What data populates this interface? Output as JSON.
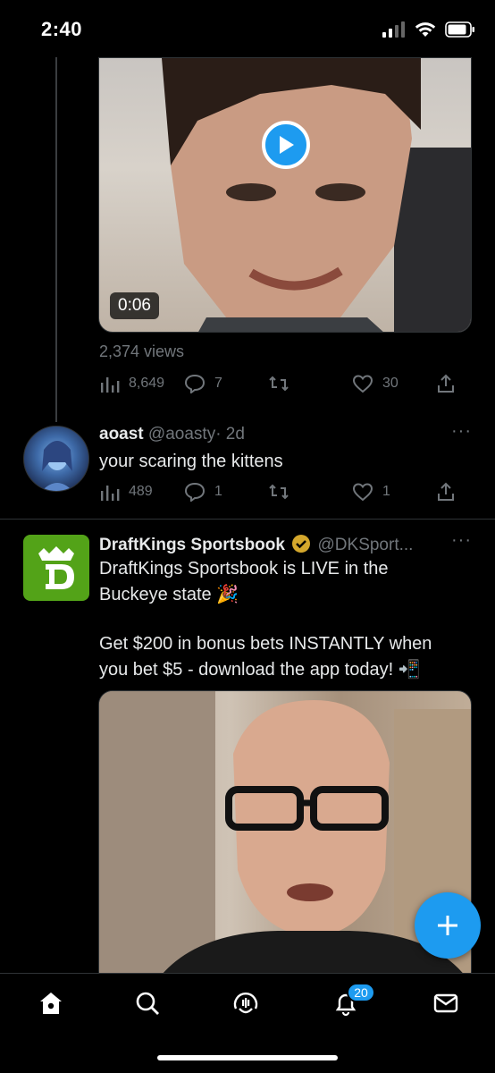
{
  "status_bar": {
    "time": "2:40"
  },
  "video_tweet": {
    "duration": "0:06",
    "views": "2,374 views",
    "analytics": "8,649",
    "replies": "7",
    "retweets": "",
    "likes": "30"
  },
  "reply_tweet": {
    "name": "aoast",
    "handle": "@aoasty",
    "time": "· 2d",
    "text": "your scaring the kittens",
    "analytics": "489",
    "replies": "1",
    "retweets": "",
    "likes": "1"
  },
  "ad_tweet": {
    "name": "DraftKings Sportsbook",
    "handle": "@DKSport...",
    "text_line1": "DraftKings Sportsbook is LIVE in the\nBuckeye state 🎉",
    "text_line2": "Get $200 in bonus bets INSTANTLY when\nyou bet $5 - download the app today! 📲"
  },
  "tabbar": {
    "notifications_badge": "20"
  },
  "colors": {
    "accent": "#1d9bf0",
    "muted": "#71767b",
    "background": "#000000",
    "draftkings_green": "#53a318"
  },
  "icons": [
    "home-icon",
    "search-icon",
    "spaces-icon",
    "notifications-icon",
    "messages-icon",
    "compose-icon",
    "play-icon",
    "verified-icon"
  ]
}
